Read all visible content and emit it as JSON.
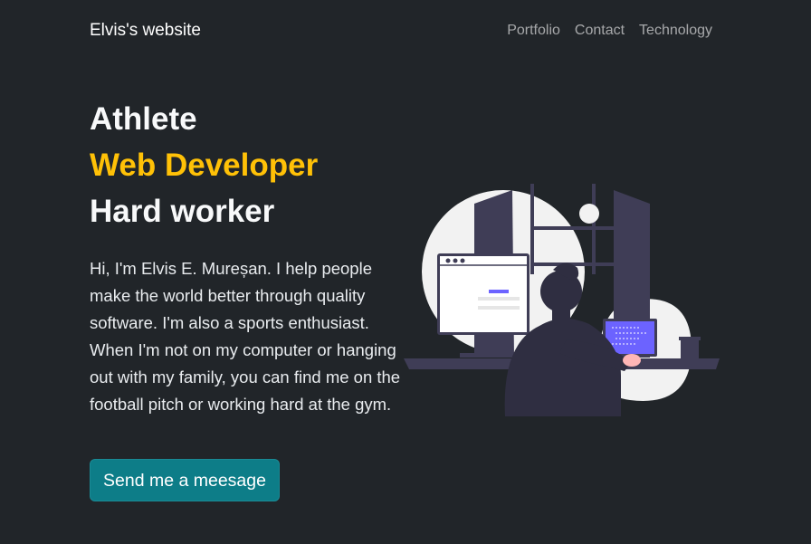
{
  "navbar": {
    "brand": "Elvis's website",
    "links": [
      "Portfolio",
      "Contact",
      "Technology"
    ]
  },
  "hero": {
    "lines": [
      "Athlete",
      "Web Developer",
      "Hard worker"
    ],
    "intro": "Hi, I'm Elvis E. Mureșan. I help people make the world better through quality software. I'm also a sports enthusiast. When I'm not on my computer or hanging out with my family, you can find me on the football pitch or working hard at the gym.",
    "cta_label": "Send me a meesage"
  },
  "colors": {
    "background": "#212529",
    "accent": "#ffc107",
    "button": "#0d7d88",
    "illustration_accent": "#6c63ff"
  }
}
